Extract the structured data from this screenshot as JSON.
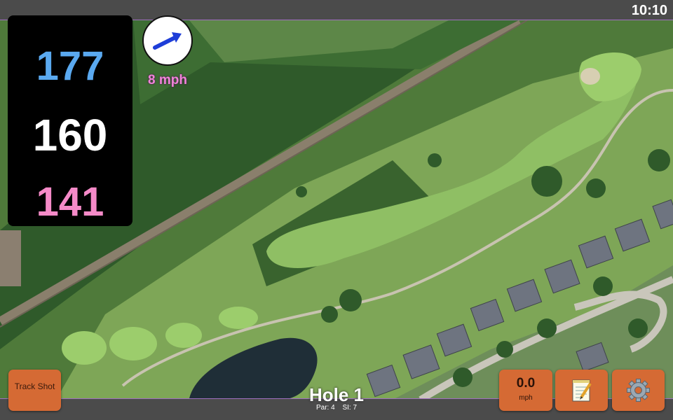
{
  "status": {
    "clock": "10:10"
  },
  "distances": {
    "back": "177",
    "middle": "160",
    "front": "141",
    "colors": {
      "back": "#5aa9f0",
      "middle": "#ffffff",
      "front": "#f58ac8"
    }
  },
  "wind": {
    "speed": "8 mph",
    "icon": "arrow-icon",
    "color": "#f084d8"
  },
  "buttons": {
    "track_shot": "Track Shot",
    "speed_value": "0.0",
    "speed_unit": "mph",
    "notes_icon": "notepad-icon",
    "settings_icon": "gear-icon"
  },
  "hole": {
    "title": "Hole 1",
    "par": "Par: 4",
    "si": "SI: 7"
  },
  "theme": {
    "button": "#d56a34",
    "bar": "#4b4b4b"
  }
}
